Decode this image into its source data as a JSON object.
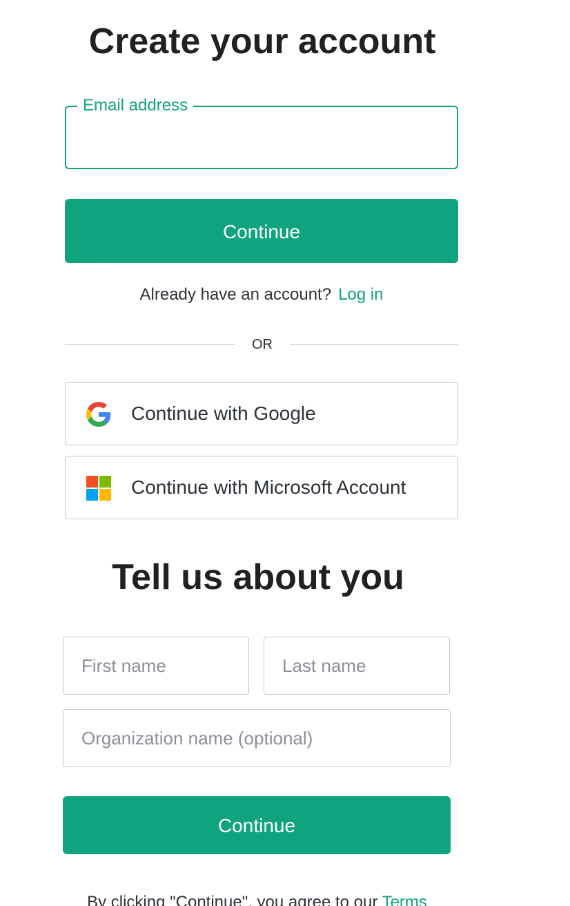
{
  "signup": {
    "title": "Create your account",
    "email": {
      "label": "Email address",
      "value": ""
    },
    "continue_label": "Continue",
    "login_prompt": "Already have an account?",
    "login_link": "Log in",
    "divider": "OR",
    "google_label": "Continue with Google",
    "microsoft_label": "Continue with Microsoft Account"
  },
  "about": {
    "title": "Tell us about you",
    "first_name_placeholder": "First name",
    "last_name_placeholder": "Last name",
    "org_placeholder": "Organization name (optional)",
    "continue_label": "Continue",
    "terms_prefix": "By clicking \"Continue\", you agree to our ",
    "terms_link": "Terms"
  },
  "colors": {
    "accent": "#10a37f",
    "border": "#c2c8d0",
    "text": "#2d333a",
    "heading": "#202123"
  },
  "icons": {
    "google": "google-logo-icon",
    "microsoft": "microsoft-logo-icon"
  }
}
